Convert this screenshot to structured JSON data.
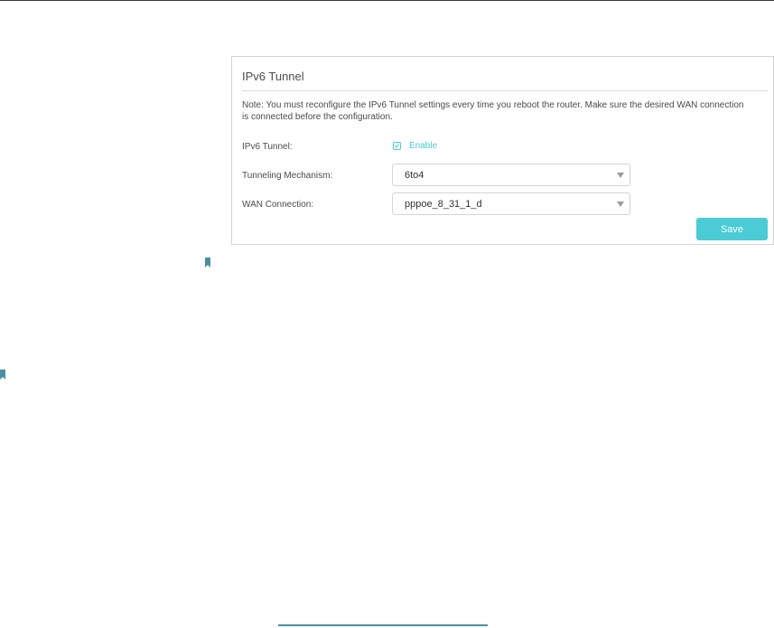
{
  "panel": {
    "title": "IPv6 Tunnel",
    "note": "Note: You must reconfigure the IPv6 Tunnel settings every time you reboot the router. Make sure the desired WAN connection is connected before the configuration.",
    "ipv6_tunnel": {
      "label": "IPv6 Tunnel:",
      "checkbox_label": "Enable",
      "checked": true
    },
    "tunneling_mechanism": {
      "label": "Tunneling Mechanism:",
      "value": "6to4"
    },
    "wan_connection": {
      "label": "WAN Connection:",
      "value": "pppoe_8_31_1_d"
    },
    "save_label": "Save"
  },
  "colors": {
    "accent": "#4acbd6",
    "bookmark": "#4a8fa1",
    "border": "#d4d4d4"
  },
  "icons": [
    "bookmark-icon",
    "checkbox-checked-icon",
    "dropdown-arrow-icon"
  ]
}
